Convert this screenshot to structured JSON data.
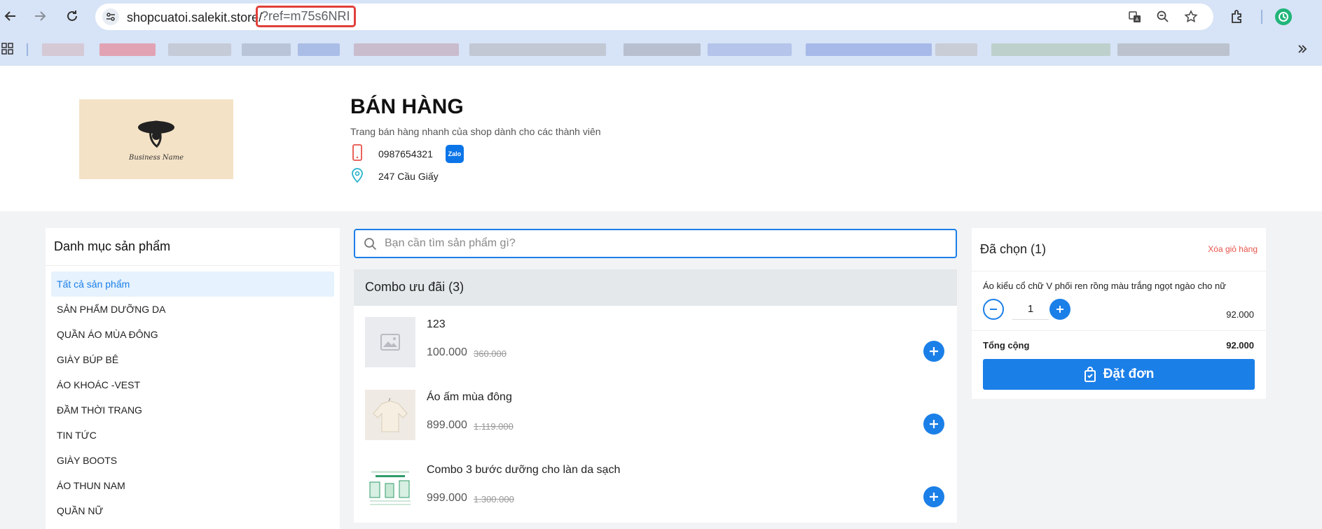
{
  "browser": {
    "url_host": "shopcuatoi.salekit.store/",
    "url_query": "?ref=m75s6NRI",
    "icons": [
      "back-icon",
      "forward-icon",
      "reload-icon",
      "site-settings-icon",
      "translate-icon",
      "zoom-icon",
      "star-icon",
      "extensions-icon",
      "profile-icon",
      "apps-icon",
      "more-bookmarks-icon"
    ]
  },
  "header": {
    "title": "BÁN HÀNG",
    "description": "Trang bán hàng nhanh của shop dành cho các thành viên",
    "phone": "0987654321",
    "zalo_label": "Zalo",
    "address": "247 Cầu Giấy",
    "logo_text": "Business Name"
  },
  "categories": {
    "title": "Danh mục sản phẩm",
    "items": [
      "Tất cả sản phẩm",
      "SẢN PHẨM DƯỠNG DA",
      "QUẦN ÁO MÙA ĐÔNG",
      "GIÀY BÚP BÊ",
      "ÁO KHOÁC -VEST",
      "ĐẦM THỜI TRANG",
      "TIN TỨC",
      "GIÀY BOOTS",
      "ÁO THUN NAM",
      "QUẦN NỮ"
    ]
  },
  "search": {
    "placeholder": "Bạn cần tìm sản phẩm gì?"
  },
  "combo": {
    "title": "Combo ưu đãi (3)",
    "products": [
      {
        "name": "123",
        "price": "100.000",
        "old_price": "360.000"
      },
      {
        "name": "Áo ấm mùa đông",
        "price": "899.000",
        "old_price": "1.119.000"
      },
      {
        "name": "Combo 3 bước dưỡng cho làn da sạch",
        "price": "999.000",
        "old_price": "1.300.000"
      }
    ]
  },
  "cart": {
    "title": "Đã chọn (1)",
    "clear_label": "Xóa giỏ hàng",
    "item_name": "Áo kiểu cổ chữ V phối ren rồng màu trắng ngọt ngào cho nữ",
    "quantity": "1",
    "item_price": "92.000",
    "total_label": "Tổng cộng",
    "total_value": "92.000",
    "order_label": "Đặt đơn"
  },
  "colors": {
    "accent": "#1b7fe8",
    "danger": "#e8534a",
    "chrome": "#d7e3f6"
  }
}
